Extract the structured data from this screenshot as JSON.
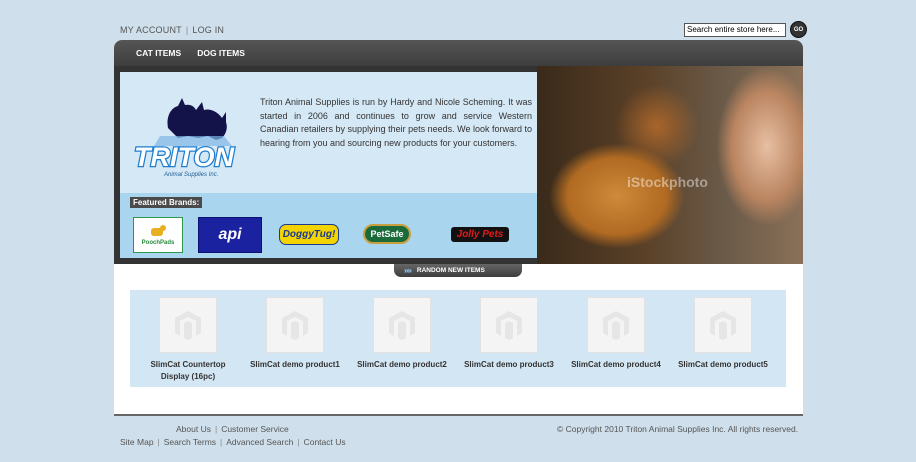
{
  "header": {
    "links": [
      "MY ACCOUNT",
      "LOG IN"
    ],
    "search": {
      "value": "Search entire store here...",
      "button": "GO"
    }
  },
  "nav": {
    "items": [
      "CAT ITEMS",
      "DOG ITEMS"
    ]
  },
  "hero": {
    "intro": "Triton Animal Supplies is run by Hardy and Nicole Scheming. It was started in 2006 and continues to grow and service Western Canadian retailers by supplying their pets needs. We look forward to hearing from you and sourcing new products for your customers.",
    "logo": {
      "title": "TRITON",
      "subtitle": "Animal Supplies Inc."
    },
    "brands_label": "Featured Brands:",
    "brands": [
      "PoochPads",
      "api",
      "DoggyTug!",
      "PetSafe",
      "Jolly Pets"
    ],
    "photo_watermark": "iStockphoto"
  },
  "random_tab": "RANDOM NEW ITEMS",
  "products": [
    {
      "name": "SlimCat Countertop Display (16pc)"
    },
    {
      "name": "SlimCat demo product1"
    },
    {
      "name": "SlimCat demo product2"
    },
    {
      "name": "SlimCat demo product3"
    },
    {
      "name": "SlimCat demo product4"
    },
    {
      "name": "SlimCat demo product5"
    }
  ],
  "footer": {
    "row1": [
      "About Us",
      "Customer Service"
    ],
    "row2": [
      "Site Map",
      "Search Terms",
      "Advanced Search",
      "Contact Us"
    ],
    "copyright": "© Copyright 2010 Triton Animal Supplies Inc. All rights reserved."
  },
  "colors": {
    "page_bg": "#cfe0ec",
    "nav_bg": "#4a4a4a",
    "panel_blue": "#d5e8f5",
    "brands_blue": "#a9d5ee",
    "logo_blue": "#1e7fd0"
  }
}
